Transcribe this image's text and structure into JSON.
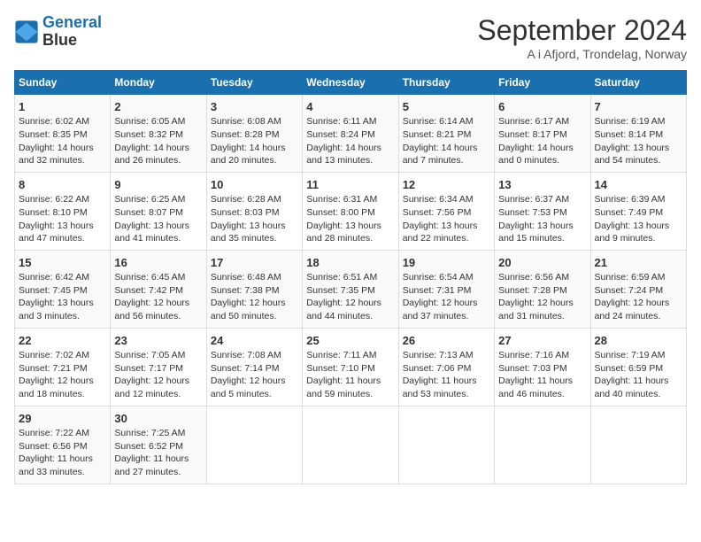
{
  "header": {
    "logo_line1": "General",
    "logo_line2": "Blue",
    "month": "September 2024",
    "location": "A i Afjord, Trondelag, Norway"
  },
  "days_of_week": [
    "Sunday",
    "Monday",
    "Tuesday",
    "Wednesday",
    "Thursday",
    "Friday",
    "Saturday"
  ],
  "weeks": [
    [
      {
        "day": "1",
        "sunrise": "Sunrise: 6:02 AM",
        "sunset": "Sunset: 8:35 PM",
        "daylight": "Daylight: 14 hours and 32 minutes."
      },
      {
        "day": "2",
        "sunrise": "Sunrise: 6:05 AM",
        "sunset": "Sunset: 8:32 PM",
        "daylight": "Daylight: 14 hours and 26 minutes."
      },
      {
        "day": "3",
        "sunrise": "Sunrise: 6:08 AM",
        "sunset": "Sunset: 8:28 PM",
        "daylight": "Daylight: 14 hours and 20 minutes."
      },
      {
        "day": "4",
        "sunrise": "Sunrise: 6:11 AM",
        "sunset": "Sunset: 8:24 PM",
        "daylight": "Daylight: 14 hours and 13 minutes."
      },
      {
        "day": "5",
        "sunrise": "Sunrise: 6:14 AM",
        "sunset": "Sunset: 8:21 PM",
        "daylight": "Daylight: 14 hours and 7 minutes."
      },
      {
        "day": "6",
        "sunrise": "Sunrise: 6:17 AM",
        "sunset": "Sunset: 8:17 PM",
        "daylight": "Daylight: 14 hours and 0 minutes."
      },
      {
        "day": "7",
        "sunrise": "Sunrise: 6:19 AM",
        "sunset": "Sunset: 8:14 PM",
        "daylight": "Daylight: 13 hours and 54 minutes."
      }
    ],
    [
      {
        "day": "8",
        "sunrise": "Sunrise: 6:22 AM",
        "sunset": "Sunset: 8:10 PM",
        "daylight": "Daylight: 13 hours and 47 minutes."
      },
      {
        "day": "9",
        "sunrise": "Sunrise: 6:25 AM",
        "sunset": "Sunset: 8:07 PM",
        "daylight": "Daylight: 13 hours and 41 minutes."
      },
      {
        "day": "10",
        "sunrise": "Sunrise: 6:28 AM",
        "sunset": "Sunset: 8:03 PM",
        "daylight": "Daylight: 13 hours and 35 minutes."
      },
      {
        "day": "11",
        "sunrise": "Sunrise: 6:31 AM",
        "sunset": "Sunset: 8:00 PM",
        "daylight": "Daylight: 13 hours and 28 minutes."
      },
      {
        "day": "12",
        "sunrise": "Sunrise: 6:34 AM",
        "sunset": "Sunset: 7:56 PM",
        "daylight": "Daylight: 13 hours and 22 minutes."
      },
      {
        "day": "13",
        "sunrise": "Sunrise: 6:37 AM",
        "sunset": "Sunset: 7:53 PM",
        "daylight": "Daylight: 13 hours and 15 minutes."
      },
      {
        "day": "14",
        "sunrise": "Sunrise: 6:39 AM",
        "sunset": "Sunset: 7:49 PM",
        "daylight": "Daylight: 13 hours and 9 minutes."
      }
    ],
    [
      {
        "day": "15",
        "sunrise": "Sunrise: 6:42 AM",
        "sunset": "Sunset: 7:45 PM",
        "daylight": "Daylight: 13 hours and 3 minutes."
      },
      {
        "day": "16",
        "sunrise": "Sunrise: 6:45 AM",
        "sunset": "Sunset: 7:42 PM",
        "daylight": "Daylight: 12 hours and 56 minutes."
      },
      {
        "day": "17",
        "sunrise": "Sunrise: 6:48 AM",
        "sunset": "Sunset: 7:38 PM",
        "daylight": "Daylight: 12 hours and 50 minutes."
      },
      {
        "day": "18",
        "sunrise": "Sunrise: 6:51 AM",
        "sunset": "Sunset: 7:35 PM",
        "daylight": "Daylight: 12 hours and 44 minutes."
      },
      {
        "day": "19",
        "sunrise": "Sunrise: 6:54 AM",
        "sunset": "Sunset: 7:31 PM",
        "daylight": "Daylight: 12 hours and 37 minutes."
      },
      {
        "day": "20",
        "sunrise": "Sunrise: 6:56 AM",
        "sunset": "Sunset: 7:28 PM",
        "daylight": "Daylight: 12 hours and 31 minutes."
      },
      {
        "day": "21",
        "sunrise": "Sunrise: 6:59 AM",
        "sunset": "Sunset: 7:24 PM",
        "daylight": "Daylight: 12 hours and 24 minutes."
      }
    ],
    [
      {
        "day": "22",
        "sunrise": "Sunrise: 7:02 AM",
        "sunset": "Sunset: 7:21 PM",
        "daylight": "Daylight: 12 hours and 18 minutes."
      },
      {
        "day": "23",
        "sunrise": "Sunrise: 7:05 AM",
        "sunset": "Sunset: 7:17 PM",
        "daylight": "Daylight: 12 hours and 12 minutes."
      },
      {
        "day": "24",
        "sunrise": "Sunrise: 7:08 AM",
        "sunset": "Sunset: 7:14 PM",
        "daylight": "Daylight: 12 hours and 5 minutes."
      },
      {
        "day": "25",
        "sunrise": "Sunrise: 7:11 AM",
        "sunset": "Sunset: 7:10 PM",
        "daylight": "Daylight: 11 hours and 59 minutes."
      },
      {
        "day": "26",
        "sunrise": "Sunrise: 7:13 AM",
        "sunset": "Sunset: 7:06 PM",
        "daylight": "Daylight: 11 hours and 53 minutes."
      },
      {
        "day": "27",
        "sunrise": "Sunrise: 7:16 AM",
        "sunset": "Sunset: 7:03 PM",
        "daylight": "Daylight: 11 hours and 46 minutes."
      },
      {
        "day": "28",
        "sunrise": "Sunrise: 7:19 AM",
        "sunset": "Sunset: 6:59 PM",
        "daylight": "Daylight: 11 hours and 40 minutes."
      }
    ],
    [
      {
        "day": "29",
        "sunrise": "Sunrise: 7:22 AM",
        "sunset": "Sunset: 6:56 PM",
        "daylight": "Daylight: 11 hours and 33 minutes."
      },
      {
        "day": "30",
        "sunrise": "Sunrise: 7:25 AM",
        "sunset": "Sunset: 6:52 PM",
        "daylight": "Daylight: 11 hours and 27 minutes."
      },
      null,
      null,
      null,
      null,
      null
    ]
  ]
}
